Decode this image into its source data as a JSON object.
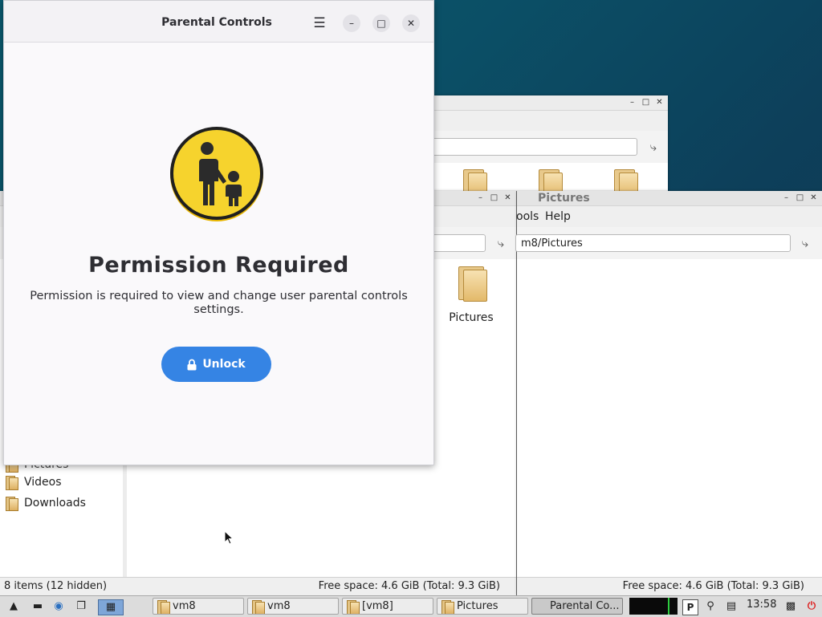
{
  "parental": {
    "title": "Parental Controls",
    "heading": "Permission Required",
    "description": "Permission is required to view and change user parental controls settings.",
    "unlock_label": "Unlock"
  },
  "fm_back": {
    "path_value": "",
    "folders": [
      "",
      "",
      ""
    ]
  },
  "fm_mid": {
    "path_value": "",
    "folder_label": "Pictures",
    "sidebar": [
      "Pictures",
      "Videos",
      "Downloads"
    ],
    "status_left": "8 items (12 hidden)",
    "status_right": "Free space: 4.6 GiB (Total: 9.3 GiB)"
  },
  "fm_right": {
    "title": "Pictures",
    "menu_tools": "ools",
    "menu_help": "Help",
    "path_value": "m8/Pictures",
    "status_right": "Free space: 4.6 GiB (Total: 9.3 GiB)"
  },
  "taskbar": {
    "tasks": [
      "vm8",
      "vm8",
      "[vm8]",
      "Pictures",
      "Parental Co..."
    ],
    "clock": "13:58",
    "tray_p": "P"
  },
  "colors": {
    "accent": "#3584e4",
    "emblem_yellow": "#f6d32d"
  }
}
